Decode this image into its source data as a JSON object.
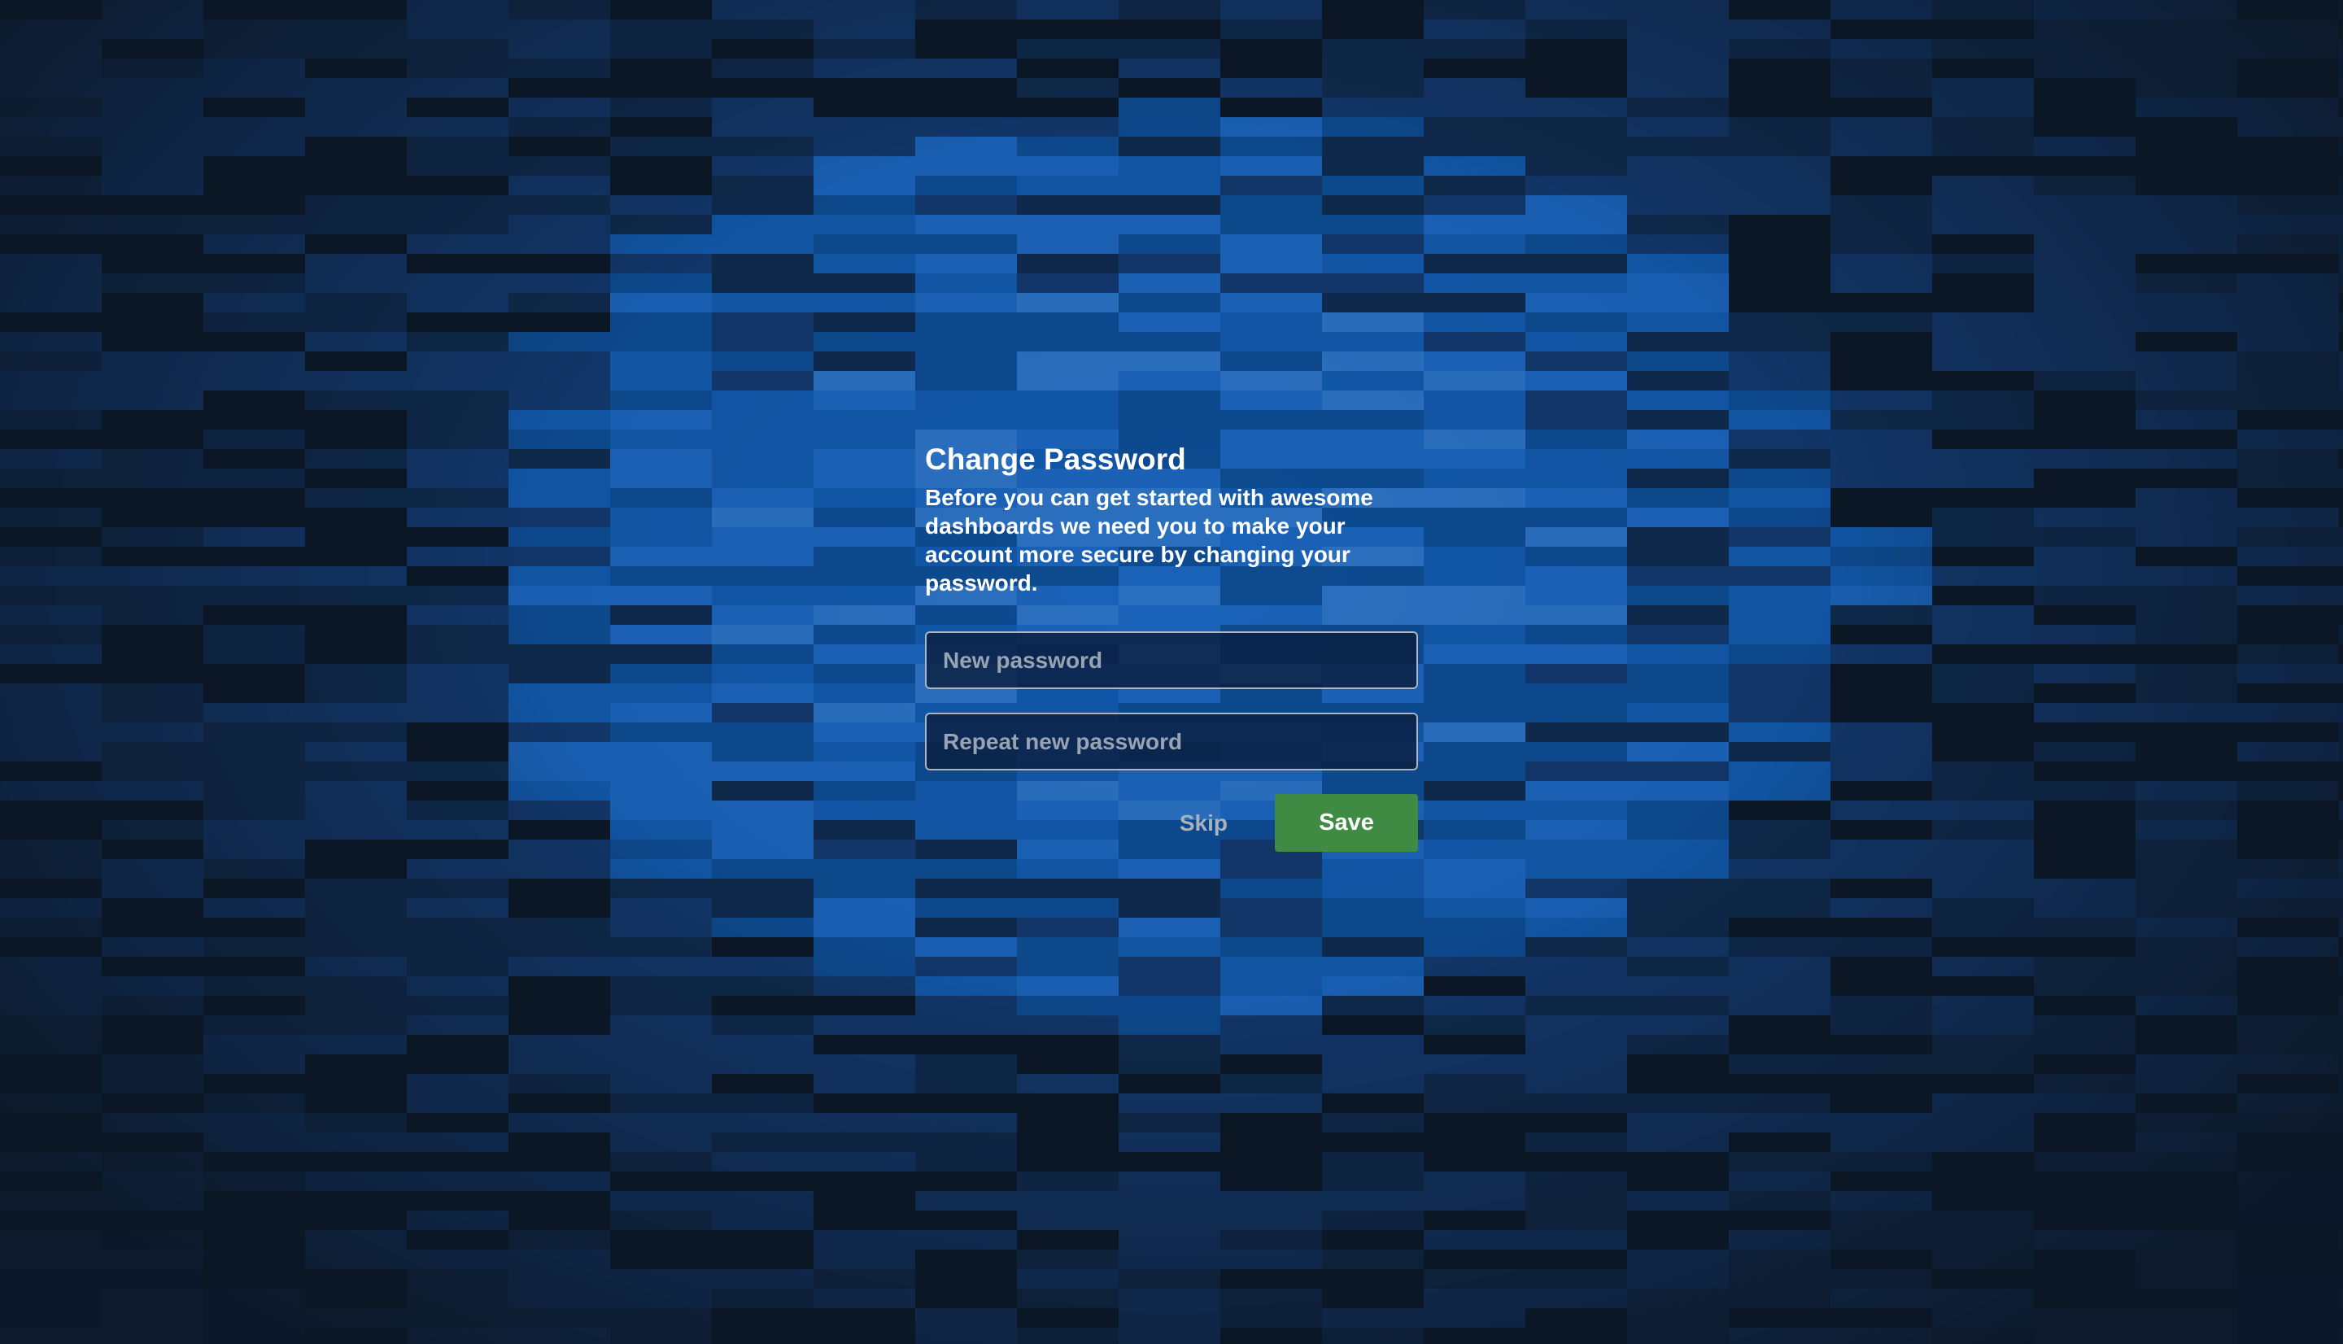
{
  "background": {
    "style": "blue pixel mosaic",
    "colors": [
      "#0c1726",
      "#0f2a4d",
      "#12376b",
      "#0d4a8f",
      "#1157a8",
      "#1a62b8",
      "#2a6fbf",
      "#153f6e",
      "#0a2340"
    ]
  },
  "change_password": {
    "title": "Change Password",
    "description": "Before you can get started with awesome dashboards we need you to make your account more secure by changing your password.",
    "new_password": {
      "value": "",
      "placeholder": "New password"
    },
    "repeat_password": {
      "value": "",
      "placeholder": "Repeat new password"
    },
    "skip_label": "Skip",
    "save_label": "Save"
  },
  "colors": {
    "save_button": "#3f8b43",
    "skip_text": "#a7b1bf",
    "field_border": "#aab4c2"
  }
}
